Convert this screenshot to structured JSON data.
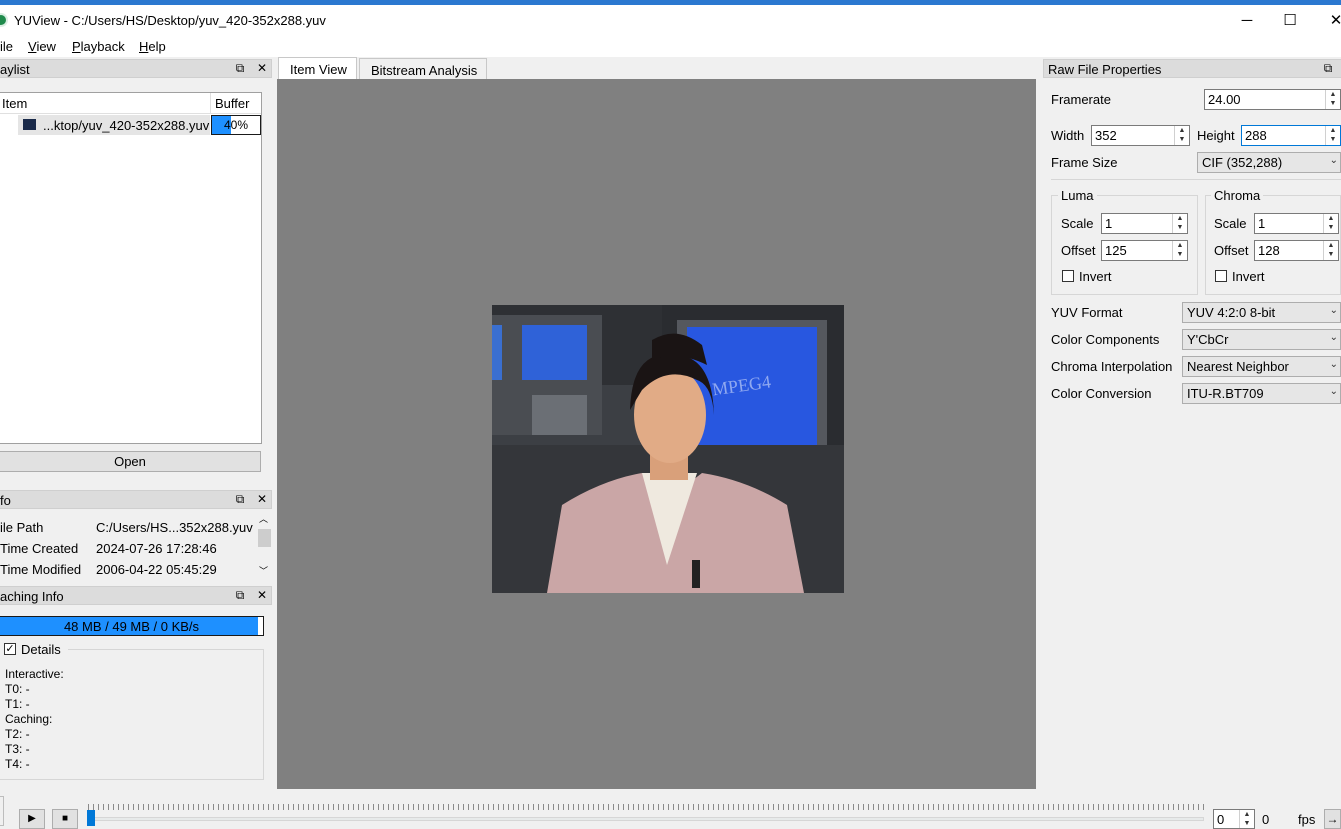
{
  "window": {
    "title": "YUView - C:/Users/HS/Desktop/yuv_420-352x288.yuv",
    "minimize": "─",
    "maximize": "☐",
    "close": "✕"
  },
  "menu": {
    "file": "ile",
    "view_u": "V",
    "view_rest": "iew",
    "playback_u": "P",
    "playback_rest": "layback",
    "help_u": "H",
    "help_rest": "elp"
  },
  "playlist": {
    "title": "aylist",
    "col_item": "Item",
    "col_buffer": "Buffer",
    "items": [
      {
        "name": "...ktop/yuv_420-352x288.yuv",
        "buffer": "40%",
        "buffer_fraction": 0.4
      }
    ],
    "open_button": "Open"
  },
  "info": {
    "title": "fo",
    "rows": [
      {
        "label": "ile Path",
        "value": "C:/Users/HS...352x288.yuv"
      },
      {
        "label": "Time Created",
        "value": "2024-07-26 17:28:46"
      },
      {
        "label": "Time Modified",
        "value": "2006-04-22 05:45:29"
      }
    ]
  },
  "caching": {
    "title": "aching Info",
    "bar_text": "48 MB / 49 MB / 0 KB/s",
    "bar_fraction": 0.98,
    "details_label": "Details",
    "details_checked": true,
    "lines": [
      "Interactive:",
      "T0: -",
      "T1: -",
      "Caching:",
      "T2: -",
      "T3: -",
      "T4: -"
    ]
  },
  "center": {
    "tabs": [
      "Item View",
      "Bitstream Analysis"
    ],
    "active_tab": 0,
    "view_bg": "#808080"
  },
  "props": {
    "title": "Raw File Properties",
    "framerate_label": "Framerate",
    "framerate": "24.00",
    "width_label": "Width",
    "width": "352",
    "height_label": "Height",
    "height": "288",
    "frame_size_label": "Frame Size",
    "frame_size": "CIF (352,288)",
    "luma": {
      "title": "Luma",
      "scale_label": "Scale",
      "scale": "1",
      "offset_label": "Offset",
      "offset": "125",
      "invert_label": "Invert"
    },
    "chroma": {
      "title": "Chroma",
      "scale_label": "Scale",
      "scale": "1",
      "offset_label": "Offset",
      "offset": "128",
      "invert_label": "Invert"
    },
    "yuv_format_label": "YUV Format",
    "yuv_format": "YUV 4:2:0 8-bit",
    "color_components_label": "Color Components",
    "color_components": "Y'CbCr",
    "chroma_interp_label": "Chroma Interpolation",
    "chroma_interp": "Nearest Neighbor",
    "color_conversion_label": "Color Conversion",
    "color_conversion": "ITU-R.BT709"
  },
  "playback": {
    "frame": "0",
    "frame_max": "0",
    "fps_label": "fps"
  },
  "colors": {
    "accent": "#1e90ff",
    "selection": "#cce4f7"
  }
}
